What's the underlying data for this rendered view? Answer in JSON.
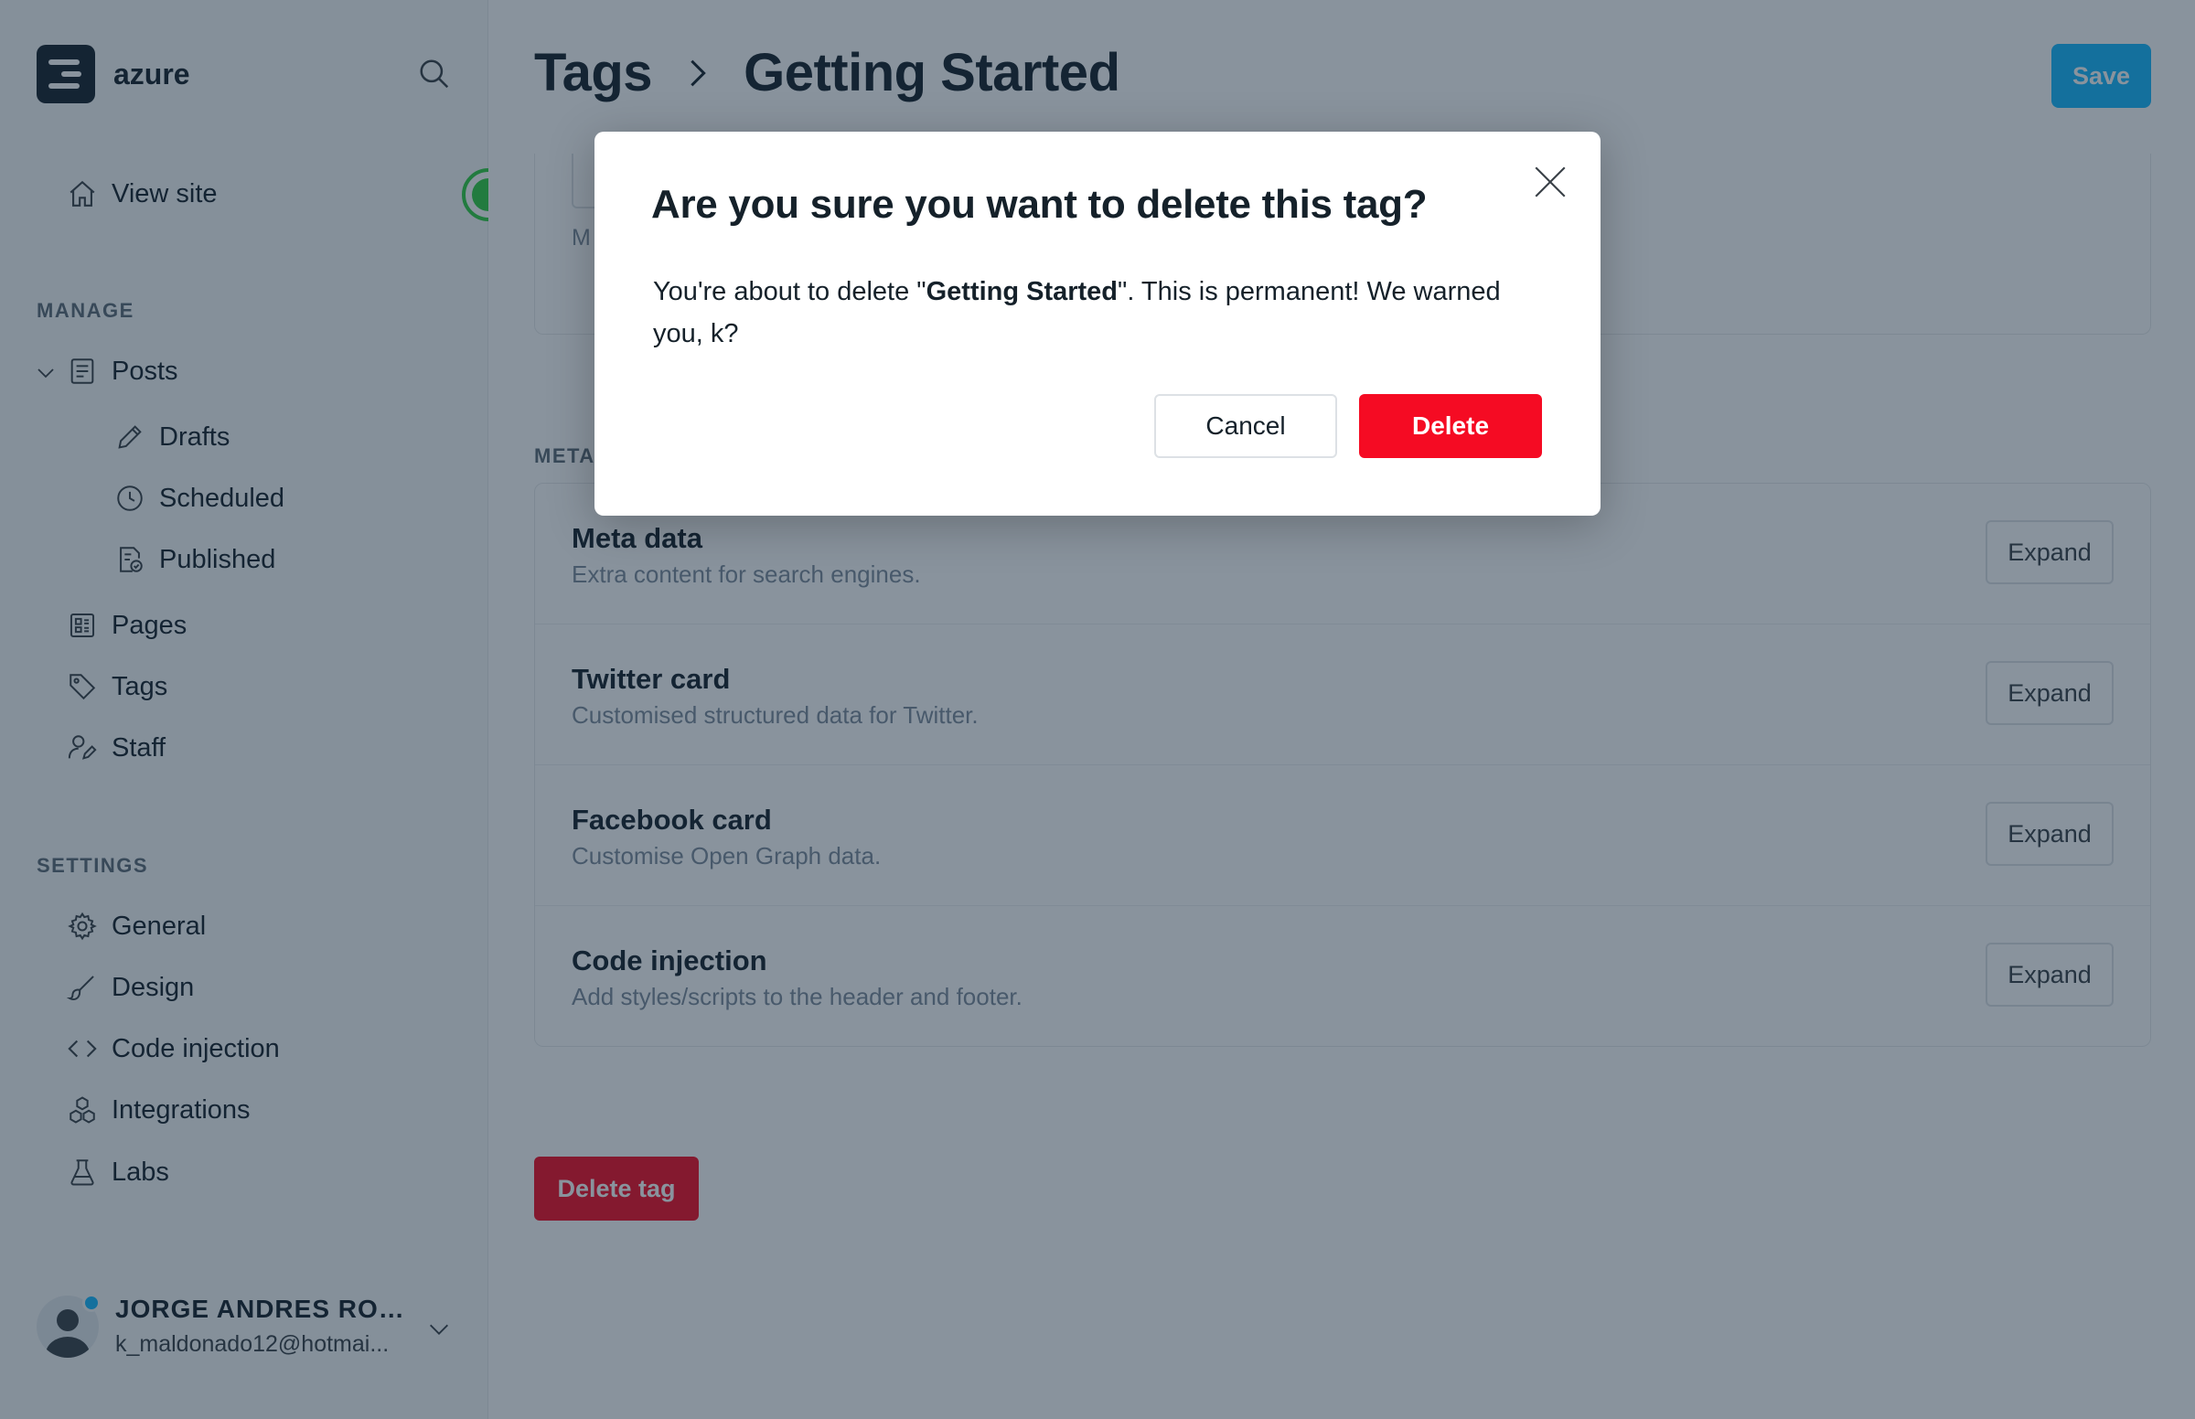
{
  "sidebar": {
    "brand_name": "azure",
    "view_site": "View site",
    "manage_heading": "MANAGE",
    "manage_items": [
      {
        "label": "Posts",
        "icon": "posts-icon"
      },
      {
        "label": "Drafts",
        "icon": "pencil-icon"
      },
      {
        "label": "Scheduled",
        "icon": "clock-icon"
      },
      {
        "label": "Published",
        "icon": "published-icon"
      },
      {
        "label": "Pages",
        "icon": "pages-icon"
      },
      {
        "label": "Tags",
        "icon": "tag-icon"
      },
      {
        "label": "Staff",
        "icon": "staff-icon"
      }
    ],
    "settings_heading": "SETTINGS",
    "settings_items": [
      {
        "label": "General",
        "icon": "gear-icon"
      },
      {
        "label": "Design",
        "icon": "brush-icon"
      },
      {
        "label": "Code injection",
        "icon": "code-icon"
      },
      {
        "label": "Integrations",
        "icon": "integrations-icon"
      },
      {
        "label": "Labs",
        "icon": "flask-icon"
      }
    ],
    "user": {
      "name": "JORGE ANDRES ROM...",
      "email": "k_maldonado12@hotmai..."
    }
  },
  "header": {
    "breadcrumb_parent": "Tags",
    "breadcrumb_current": "Getting Started",
    "save_label": "Save"
  },
  "top_card": {
    "hint_text": "M"
  },
  "meta": {
    "heading": "META",
    "expand_label": "Expand",
    "rows": [
      {
        "title": "Meta data",
        "description": "Extra content for search engines."
      },
      {
        "title": "Twitter card",
        "description": "Customised structured data for Twitter."
      },
      {
        "title": "Facebook card",
        "description": "Customise Open Graph data."
      },
      {
        "title": "Code injection",
        "description": "Add styles/scripts to the header and footer."
      }
    ]
  },
  "delete_tag_label": "Delete tag",
  "modal": {
    "title": "Are you sure you want to delete this tag?",
    "body_prefix": "You're about to delete \"",
    "body_tag_name": "Getting Started",
    "body_suffix": "\". This is permanent! We warned you, k?",
    "cancel_label": "Cancel",
    "delete_label": "Delete"
  },
  "colors": {
    "accent": "#14b8ff",
    "danger": "#f50b23",
    "text": "#15212a",
    "muted": "#7c8b9a",
    "online": "#30cf43"
  }
}
